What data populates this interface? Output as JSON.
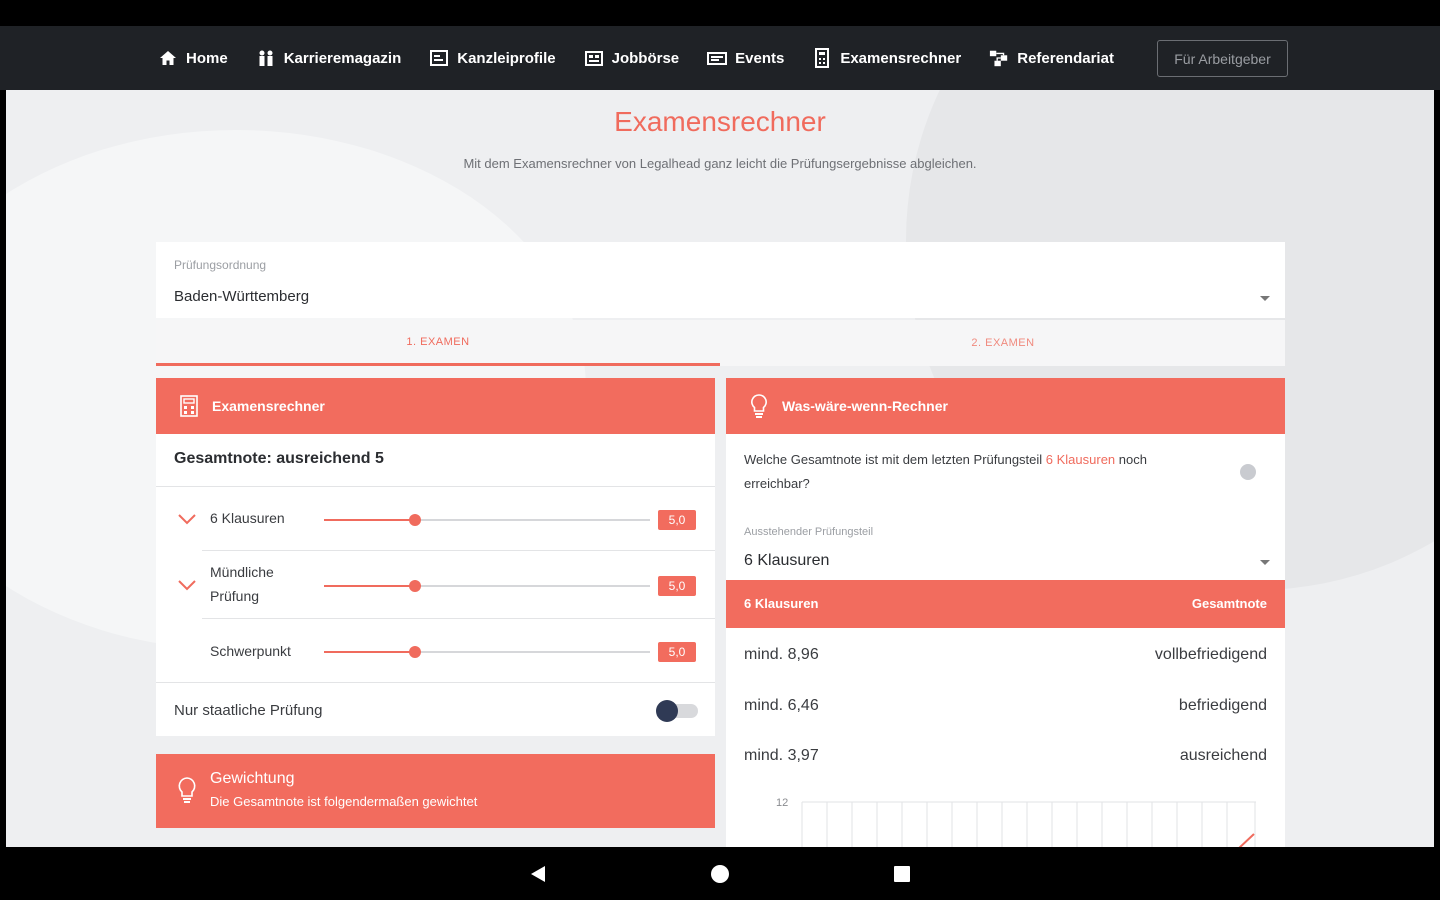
{
  "nav": {
    "items": [
      {
        "label": "Home",
        "icon": "home-icon"
      },
      {
        "label": "Karrieremagazin",
        "icon": "people-icon"
      },
      {
        "label": "Kanzleiprofile",
        "icon": "profile-icon"
      },
      {
        "label": "Jobbörse",
        "icon": "briefcase-icon"
      },
      {
        "label": "Events",
        "icon": "ticket-icon"
      },
      {
        "label": "Examensrechner",
        "icon": "calculator-icon"
      },
      {
        "label": "Referendariat",
        "icon": "network-icon"
      }
    ],
    "employer_button": "Für Arbeitgeber"
  },
  "header": {
    "title": "Examensrechner",
    "subtitle": "Mit dem Examensrechner von Legalhead ganz leicht die Prüfungsergebnisse abgleichen."
  },
  "pruefungsordnung": {
    "label": "Prüfungsordnung",
    "value": "Baden-Württemberg"
  },
  "tabs": [
    {
      "label": "1. EXAMEN",
      "active": true
    },
    {
      "label": "2. EXAMEN",
      "active": false
    }
  ],
  "calculator": {
    "title": "Examensrechner",
    "gesamtnote": "Gesamtnote: ausreichend 5",
    "rows": [
      {
        "label": "6 Klausuren",
        "value": "5,0",
        "level": 0.28,
        "expandable": true
      },
      {
        "label": "Mündliche Prüfung",
        "value": "5,0",
        "level": 0.28,
        "expandable": true
      },
      {
        "label": "Schwerpunkt",
        "value": "5,0",
        "level": 0.28,
        "expandable": false
      }
    ],
    "state_only_label": "Nur staatliche Prüfung",
    "state_only_on": false
  },
  "weighting": {
    "title": "Gewichtung",
    "subtitle": "Die Gesamtnote ist folgendermaßen gewichtet"
  },
  "whatif": {
    "title": "Was-wäre-wenn-Rechner",
    "question_pre": "Welche Gesamtnote ist mit dem letzten Prüfungsteil ",
    "question_highlight": "6 Klausuren",
    "question_post": " noch erreichbar?",
    "outstanding_label": "Ausstehender Prüfungsteil",
    "outstanding_value": "6 Klausuren",
    "table_header": {
      "left": "6 Klausuren",
      "right": "Gesamtnote"
    },
    "rows": [
      {
        "left": "mind. 8,96",
        "right": "vollbefriedigend"
      },
      {
        "left": "mind. 6,46",
        "right": "befriedigend"
      },
      {
        "left": "mind. 3,97",
        "right": "ausreichend"
      }
    ],
    "chart_ytick": "12"
  },
  "colors": {
    "accent": "#f26c5e",
    "nav_bg": "#1f2226",
    "page_bg": "#eeeff1"
  }
}
